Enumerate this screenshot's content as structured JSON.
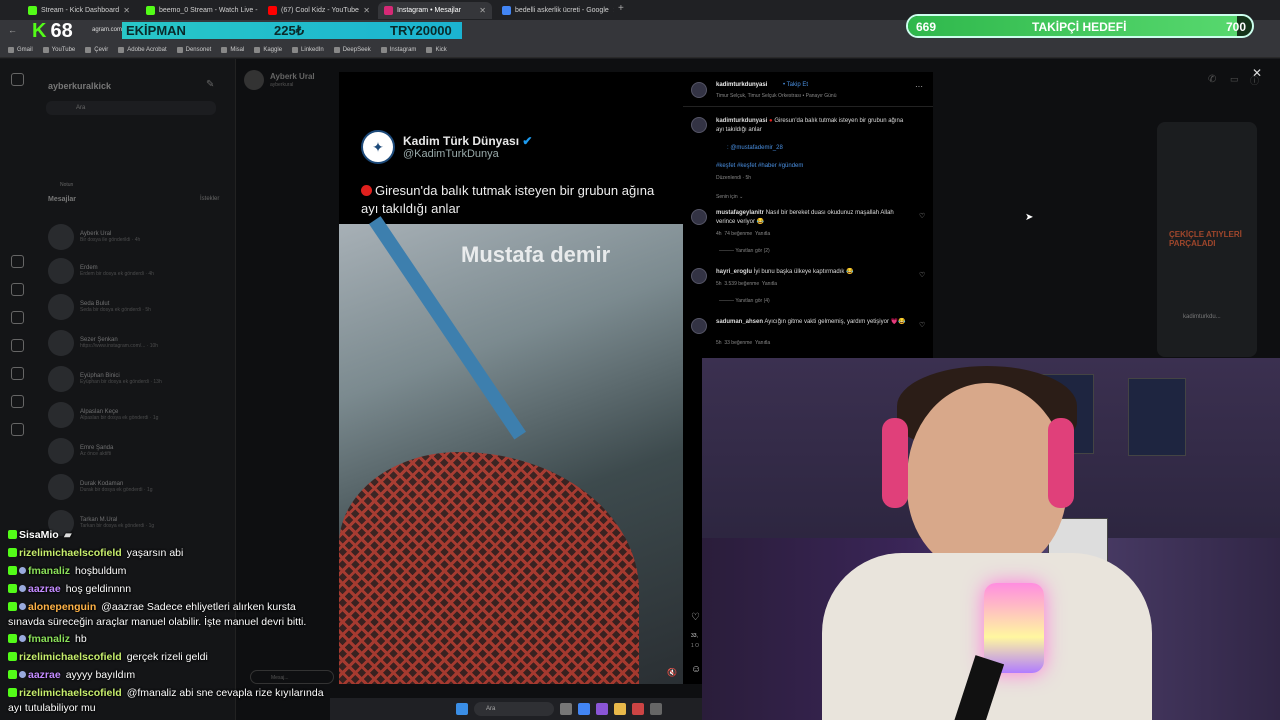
{
  "browser": {
    "tabs": [
      {
        "title": "Stream - Kick Dashboard",
        "color": "#53fc18",
        "active": false
      },
      {
        "title": "beemo_0 Stream - Watch Live -",
        "color": "#53fc18",
        "active": false
      },
      {
        "title": "(67) Cool Kidz - YouTube",
        "color": "#ff0000",
        "active": false
      },
      {
        "title": "Instagram • Mesajlar",
        "color": "#d62976",
        "active": true
      },
      {
        "title": "bedelli askerlik ücreti - Google",
        "color": "#4285f4",
        "active": false
      }
    ],
    "url_fragment": "agram.com",
    "bookmarks": [
      "Gmail",
      "YouTube",
      "Çevir",
      "Adobe Acrobat",
      "Densonet",
      "Misal",
      "Kaggle",
      "LinkedIn",
      "DeepSeek",
      "Instagram",
      "Kick"
    ]
  },
  "overlay": {
    "viewer_count": "68",
    "ekipman_label": "EKİPMAN",
    "ekipman_price": "225₺",
    "ekipman_target": "TRY20000",
    "goal_current": "669",
    "goal_label": "TAKİPÇİ HEDEFİ",
    "goal_target": "700",
    "goal_fraction": 0.956
  },
  "instagram": {
    "username": "ayberkuralkick",
    "search_placeholder": "Ara",
    "messages_heading": "Mesajlar",
    "requests_label": "İstekler",
    "notes_label": "Notun",
    "conversations": [
      {
        "name": "Ayberk Ural",
        "snippet": "Bir dosya ile gönderildi · 4h"
      },
      {
        "name": "Erdem",
        "snippet": "Erdem bir dosya ek gönderdi · 4h"
      },
      {
        "name": "Seda Bulut",
        "snippet": "Seda bir dosya ek gönderdi · 5h"
      },
      {
        "name": "Sezer Şenkan",
        "snippet": "https://www.instagram.com/... · 10h"
      },
      {
        "name": "Eyüphan Binici",
        "snippet": "Eyüphan bir dosya ek gönderdi · 13h"
      },
      {
        "name": "Alpaslan Keçe",
        "snippet": "Alpaslan bir dosya ek gönderdi · 1g"
      },
      {
        "name": "Emre Şanda",
        "snippet": "Az önce aktifti"
      },
      {
        "name": "Durak Kodaman",
        "snippet": "Durak bir dosya ek gönderdi · 1g"
      },
      {
        "name": "Tarkan M.Ural",
        "snippet": "Tarkan bir dosya ek gönderdi · 1g"
      }
    ],
    "chat_header_name": "Ayberk Ural",
    "chat_header_sub": "ayberkural",
    "message_placeholder": "Mesaj..."
  },
  "post": {
    "tweet_name": "Kadim Türk Dünyası",
    "tweet_handle": "@KadimTurkDunya",
    "tweet_text": "Giresun'da balık tutmak isteyen bir grubun ağına ayı takıldığı anlar",
    "watermark": "Mustafa demir",
    "author": "kadimturkdunyasi",
    "follow_label": "Takip Et",
    "audio": "Timur Selçuk, Timur Selçuk Orkestrası • Panayır Günü",
    "caption_user": "kadimturkdunyasi",
    "caption": "Giresun'da balık tutmak isteyen bir grubun ağına ayı takıldığı anlar",
    "caption_mention": ": @mustafademir_28",
    "hashtags": "#keşfet #keşfet #haber #gündem",
    "edited": "Düzenlendi · 5h",
    "sort_label": "Senin için",
    "comments": [
      {
        "user": "mustafageylanitr",
        "text": "Nasıl bir bereket duası okudunuz maşallah Allah verince veriyor 😂",
        "age": "4h",
        "likes": "74 beğenme",
        "reply": "Yanıtla",
        "replies": "Yanıtları gör (2)"
      },
      {
        "user": "hayri_eroglu",
        "text": "İyi bunu başka ülkeye kaptırmadık 😂",
        "age": "5h",
        "likes": "3.539 beğenme",
        "reply": "Yanıtla",
        "replies": "Yanıtları gör (4)"
      },
      {
        "user": "saduman_ahsen",
        "text": "Ayıcığın gitme vakti gelmemiş, yardım yetişiyor 💗😂",
        "age": "5h",
        "likes": "33 beğenme",
        "reply": "Yanıtla",
        "replies": ""
      }
    ],
    "likes_partial": "33,",
    "date_partial": "1 O"
  },
  "reel_preview": {
    "title": "ÇEKİÇLE ATIYLERİ PARÇALADI",
    "author": "kadimturkdu..."
  },
  "chat": [
    {
      "user": "SisaMio",
      "text": "",
      "color": "c-white",
      "sub": false
    },
    {
      "user": "rizelimichaelscofield",
      "text": "yaşarsın abi",
      "color": "c-lime",
      "sub": false
    },
    {
      "user": "fmanaliz",
      "text": "hoşbuldum",
      "color": "c-green",
      "sub": true
    },
    {
      "user": "aazrae",
      "text": "hoş geldinnnn",
      "color": "c-purple",
      "sub": true
    },
    {
      "user": "alonepenguin",
      "text": "@aazrae Sadece ehliyetleri alırken kursta sınavda süreceğin araçlar manuel olabilir. İşte manuel devri bitti.",
      "color": "c-orange",
      "sub": true
    },
    {
      "user": "fmanaliz",
      "text": "hb",
      "color": "c-green",
      "sub": true
    },
    {
      "user": "rizelimichaelscofield",
      "text": "gerçek rizeli geldi",
      "color": "c-lime",
      "sub": false
    },
    {
      "user": "aazrae",
      "text": "ayyyy bayıldım",
      "color": "c-purple",
      "sub": true
    },
    {
      "user": "rizelimichaelscofield",
      "text": "@fmanaliz abi sne cevapla rize kıyılarında ayı tutulabiliyor mu",
      "color": "c-lime",
      "sub": false
    }
  ],
  "taskbar": {
    "search_placeholder": "Ara"
  }
}
